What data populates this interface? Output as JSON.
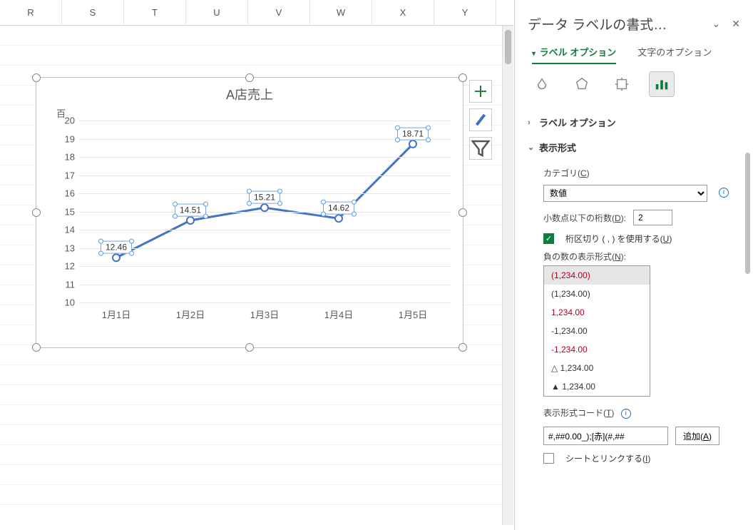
{
  "columns": [
    "R",
    "S",
    "T",
    "U",
    "V",
    "W",
    "X",
    "Y"
  ],
  "chart_data": {
    "type": "line",
    "title": "A店売上",
    "axis_unit_label": "百",
    "categories": [
      "1月1日",
      "1月2日",
      "1月3日",
      "1月4日",
      "1月5日"
    ],
    "values": [
      12.46,
      14.51,
      15.21,
      14.62,
      18.71
    ],
    "data_labels": [
      "12.46",
      "14.51",
      "15.21",
      "14.62",
      "18.71"
    ],
    "ylim": [
      10,
      20
    ],
    "ytick_step": 1,
    "xlabel": "",
    "ylabel": ""
  },
  "format_pane": {
    "title": "データ ラベルの書式…",
    "tabs": {
      "label": "ラベル オプション",
      "text": "文字のオプション"
    },
    "sections": {
      "label_options_head": "ラベル オプション",
      "number_format_head": "表示形式",
      "category_label": "カテゴリ(C)",
      "category_value": "数値",
      "decimal_label": "小数点以下の桁数(D):",
      "decimal_value": "2",
      "thousands_label": "桁区切り ( , ) を使用する(U)",
      "negatives_label": "負の数の表示形式(N):",
      "negatives": [
        {
          "text": "(1,234.00)",
          "red": true,
          "selected": true
        },
        {
          "text": "(1,234.00)",
          "red": false,
          "selected": false
        },
        {
          "text": "1,234.00",
          "red": true,
          "selected": false
        },
        {
          "text": "-1,234.00",
          "red": false,
          "selected": false
        },
        {
          "text": "-1,234.00",
          "red": true,
          "selected": false
        },
        {
          "text": "△ 1,234.00",
          "red": false,
          "selected": false
        },
        {
          "text": "▲ 1,234.00",
          "red": false,
          "selected": false
        }
      ],
      "code_label": "表示形式コード(T)",
      "code_value": "#,##0.00_);[赤](#,##",
      "add_button": "追加(A)",
      "link_label": "シートとリンクする(I)"
    }
  }
}
